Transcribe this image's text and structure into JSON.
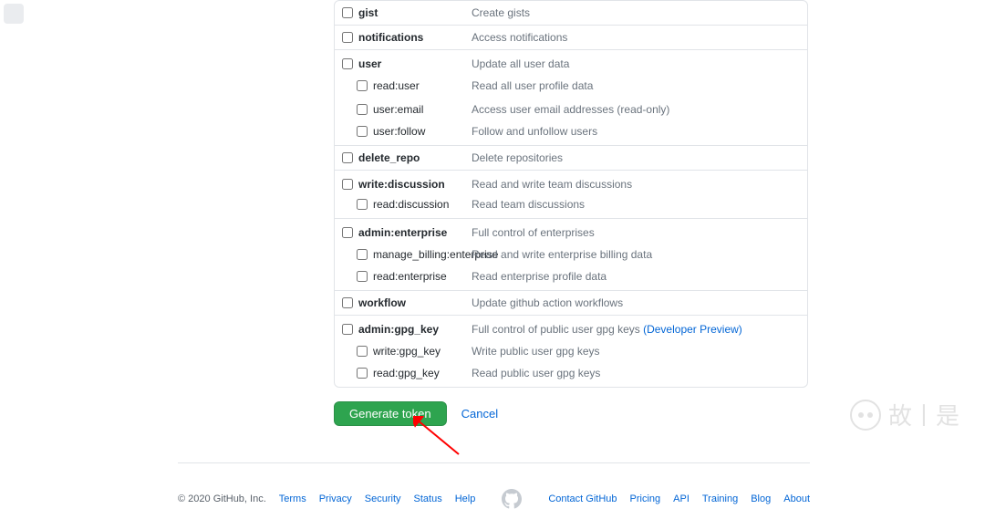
{
  "scopes": [
    {
      "id": "gist",
      "items": [
        {
          "key": "gist",
          "desc": "Create gists"
        }
      ]
    },
    {
      "id": "notifications",
      "items": [
        {
          "key": "notifications",
          "desc": "Access notifications"
        }
      ]
    },
    {
      "id": "user",
      "items": [
        {
          "key": "user",
          "desc": "Update all user data"
        },
        {
          "key": "read:user",
          "desc": "Read all user profile data"
        },
        {
          "key": "user:email",
          "desc": "Access user email addresses (read-only)"
        },
        {
          "key": "user:follow",
          "desc": "Follow and unfollow users"
        }
      ]
    },
    {
      "id": "delete_repo",
      "items": [
        {
          "key": "delete_repo",
          "desc": "Delete repositories"
        }
      ]
    },
    {
      "id": "write_discussion",
      "items": [
        {
          "key": "write:discussion",
          "desc": "Read and write team discussions"
        },
        {
          "key": "read:discussion",
          "desc": "Read team discussions"
        }
      ]
    },
    {
      "id": "admin_enterprise",
      "items": [
        {
          "key": "admin:enterprise",
          "desc": "Full control of enterprises"
        },
        {
          "key": "manage_billing:enterprise",
          "desc": "Read and write enterprise billing data"
        },
        {
          "key": "read:enterprise",
          "desc": "Read enterprise profile data"
        }
      ]
    },
    {
      "id": "workflow",
      "items": [
        {
          "key": "workflow",
          "desc": "Update github action workflows"
        }
      ]
    },
    {
      "id": "admin_gpg_key",
      "items": [
        {
          "key": "admin:gpg_key",
          "desc": "Full control of public user gpg keys ",
          "suffix": "(Developer Preview)"
        },
        {
          "key": "write:gpg_key",
          "desc": "Write public user gpg keys"
        },
        {
          "key": "read:gpg_key",
          "desc": "Read public user gpg keys"
        }
      ]
    }
  ],
  "actions": {
    "generate": "Generate token",
    "cancel": "Cancel"
  },
  "footer": {
    "copyright": "© 2020 GitHub, Inc.",
    "left": [
      "Terms",
      "Privacy",
      "Security",
      "Status",
      "Help"
    ],
    "right": [
      "Contact GitHub",
      "Pricing",
      "API",
      "Training",
      "Blog",
      "About"
    ]
  },
  "watermark": "故丨是"
}
